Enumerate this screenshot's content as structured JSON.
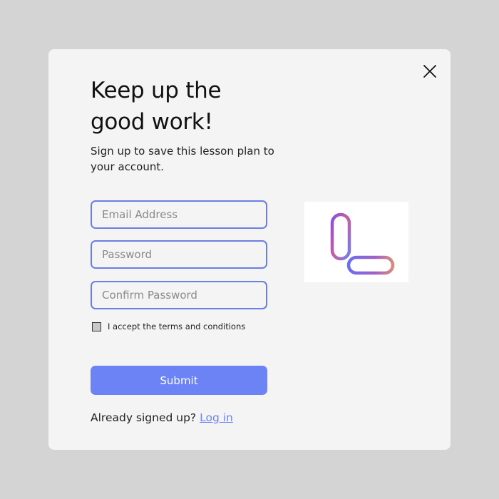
{
  "modal": {
    "title": "Keep up the good work!",
    "subtitle": "Sign up to save this lesson plan to your account.",
    "close_icon": "close-icon"
  },
  "form": {
    "email_placeholder": "Email Address",
    "password_placeholder": "Password",
    "confirm_placeholder": "Confirm Password",
    "terms_label": "I accept the terms and conditions",
    "terms_checked": false,
    "submit_label": "Submit"
  },
  "footer": {
    "prompt": "Already signed up?",
    "login_link": "Log in"
  },
  "logo": {
    "icon": "l-letter-logo"
  },
  "colors": {
    "accent": "#6b83f4",
    "field_border": "#6b7ee3",
    "background": "#d4d4d4",
    "modal": "#f4f4f4"
  }
}
